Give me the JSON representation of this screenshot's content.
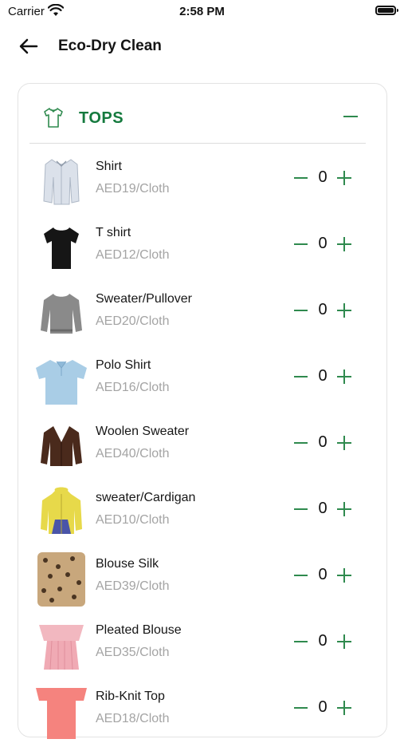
{
  "status_bar": {
    "carrier": "Carrier",
    "time": "2:58 PM"
  },
  "header": {
    "title": "Eco-Dry Clean"
  },
  "section": {
    "title": "TOPS",
    "icon": "shirt-icon"
  },
  "items": [
    {
      "name": "Shirt",
      "price": "AED19/Cloth",
      "qty": "0",
      "image": "shirt-image"
    },
    {
      "name": "T shirt",
      "price": "AED12/Cloth",
      "qty": "0",
      "image": "tshirt-image"
    },
    {
      "name": "Sweater/Pullover",
      "price": "AED20/Cloth",
      "qty": "0",
      "image": "pullover-image"
    },
    {
      "name": "Polo Shirt",
      "price": "AED16/Cloth",
      "qty": "0",
      "image": "polo-image"
    },
    {
      "name": "Woolen Sweater",
      "price": "AED40/Cloth",
      "qty": "0",
      "image": "woolen-sweater-image"
    },
    {
      "name": "sweater/Cardigan",
      "price": "AED10/Cloth",
      "qty": "0",
      "image": "cardigan-image"
    },
    {
      "name": "Blouse Silk",
      "price": "AED39/Cloth",
      "qty": "0",
      "image": "blouse-silk-image"
    },
    {
      "name": "Pleated Blouse",
      "price": "AED35/Cloth",
      "qty": "0",
      "image": "pleated-blouse-image"
    },
    {
      "name": "Rib-Knit Top",
      "price": "AED18/Cloth",
      "qty": "0",
      "image": "rib-knit-top-image"
    }
  ],
  "colors": {
    "accent": "#2f8a4e",
    "section_title": "#157a3e",
    "price_text": "#a4a4a4"
  }
}
